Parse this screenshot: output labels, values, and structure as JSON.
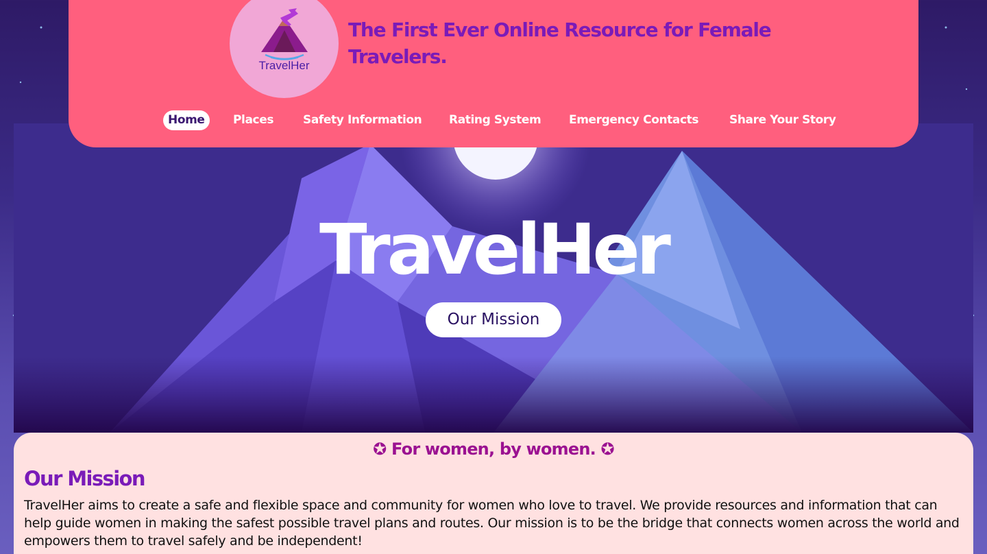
{
  "header": {
    "logo_text": "TravelHer",
    "tagline": "The First Ever Online Resource for Female Travelers."
  },
  "nav": {
    "items": [
      {
        "label": "Home",
        "active": true
      },
      {
        "label": "Places",
        "active": false
      },
      {
        "label": "Safety Information",
        "active": false
      },
      {
        "label": "Rating System",
        "active": false
      },
      {
        "label": "Emergency Contacts",
        "active": false
      },
      {
        "label": "Share Your Story",
        "active": false
      }
    ]
  },
  "hero": {
    "title": "TravelHer",
    "button_label": "Our Mission"
  },
  "content": {
    "slogan": "✪ For women, by women. ✪",
    "heading": "Our Mission",
    "body": "TravelHer aims to create a safe and flexible space and community for women who love to travel. We provide resources and information that can help guide women in making the safest possible travel plans and routes. Our mission is to be the bridge that connects women across the world and empowers them to travel safely and be independent!"
  },
  "colors": {
    "header_bg": "#ff5f7e",
    "accent_purple": "#7a1bb8",
    "slogan_magenta": "#9b1191",
    "content_bg": "#ffe1e1",
    "logo_bg": "#f1a7d6"
  },
  "icons": {
    "logo": "mountain-airplane-logo",
    "hero_art": "night-mountains-moon-illustration"
  }
}
